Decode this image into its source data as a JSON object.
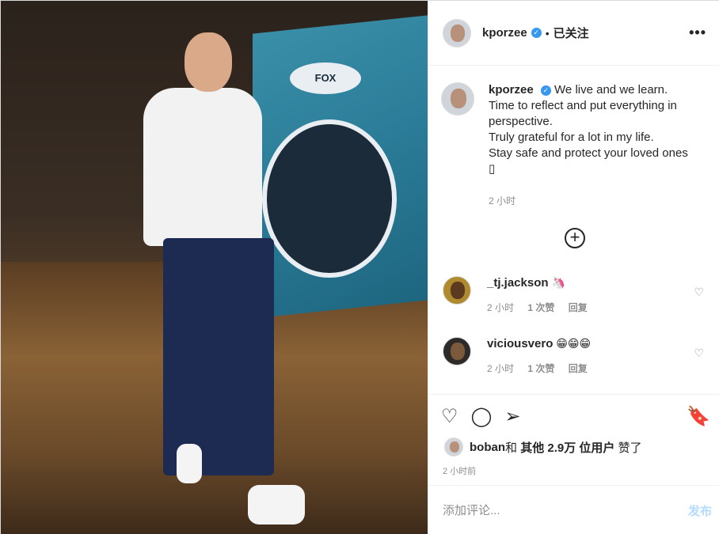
{
  "post": {
    "image_alt": "Photo"
  },
  "header": {
    "username": "kporzee",
    "verified_mark": "✓",
    "separator": "•",
    "follow_status": "已关注",
    "more": "•••"
  },
  "caption": {
    "username": "kporzee",
    "lines": [
      "We live and we learn.",
      "Time to reflect and put everything in",
      "perspective.",
      "Truly grateful for a lot in my life.",
      "Stay safe and protect your loved ones",
      "▯"
    ],
    "time": "2 小时"
  },
  "load_more": "+",
  "comments": [
    {
      "username": "_tj.jackson",
      "text": "🦄",
      "time": "2 小时",
      "likes": "1 次赞",
      "reply": "回复"
    },
    {
      "username": "viciousvero",
      "text": "😁😁😁",
      "time": "2 小时",
      "likes": "1 次赞",
      "reply": "回复"
    }
  ],
  "actions": {
    "like": "♡",
    "comment": "◯",
    "share": "➢",
    "save": "🔖"
  },
  "likes": {
    "first_user": "boban",
    "connector": "和",
    "others": "其他 2.9万 位用户",
    "suffix": "赞了"
  },
  "post_time": "2 小时前",
  "add_comment": {
    "placeholder": "添加评论...",
    "publish": "发布"
  }
}
